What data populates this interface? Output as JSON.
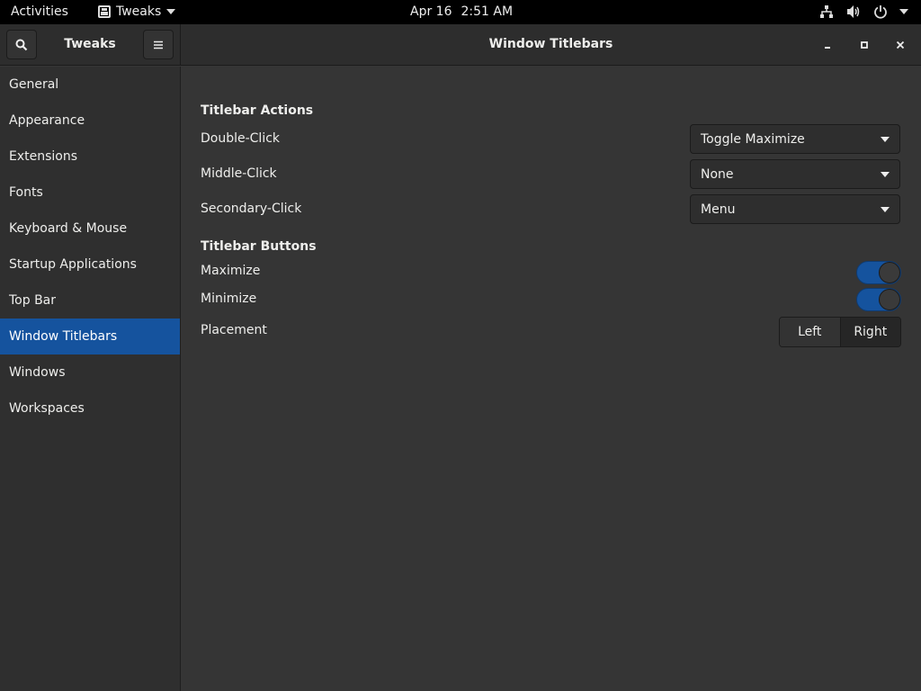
{
  "topbar": {
    "activities": "Activities",
    "app_name": "Tweaks",
    "date": "Apr 16",
    "time": "2:51 AM"
  },
  "headerbar": {
    "left_title": "Tweaks",
    "title": "Window Titlebars"
  },
  "sidebar": {
    "items": [
      {
        "label": "General"
      },
      {
        "label": "Appearance"
      },
      {
        "label": "Extensions"
      },
      {
        "label": "Fonts"
      },
      {
        "label": "Keyboard & Mouse"
      },
      {
        "label": "Startup Applications"
      },
      {
        "label": "Top Bar"
      },
      {
        "label": "Window Titlebars"
      },
      {
        "label": "Windows"
      },
      {
        "label": "Workspaces"
      }
    ],
    "active_index": 7
  },
  "content": {
    "actions_title": "Titlebar Actions",
    "double_click": {
      "label": "Double-Click",
      "value": "Toggle Maximize"
    },
    "middle_click": {
      "label": "Middle-Click",
      "value": "None"
    },
    "secondary_click": {
      "label": "Secondary-Click",
      "value": "Menu"
    },
    "buttons_title": "Titlebar Buttons",
    "maximize": {
      "label": "Maximize",
      "enabled": true
    },
    "minimize": {
      "label": "Minimize",
      "enabled": true
    },
    "placement": {
      "label": "Placement",
      "options": [
        "Left",
        "Right"
      ],
      "selected": "Right"
    }
  },
  "colors": {
    "accent": "#15539e",
    "bg": "#353535",
    "sidebar_bg": "#2f2f2f"
  }
}
